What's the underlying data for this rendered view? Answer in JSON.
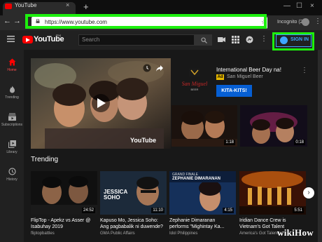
{
  "browser": {
    "tab_title": "YouTube",
    "tab_close": "×",
    "new_tab": "+",
    "url": "https://www.youtube.com",
    "incognito_label": "Incognito (2)",
    "window_controls": [
      "—",
      "☐",
      "×"
    ]
  },
  "youtube": {
    "logo_text": "YouTube",
    "logo_sup": "PH",
    "search_placeholder": "Search",
    "sign_in_label": "SIGN IN"
  },
  "sidebar": {
    "items": [
      {
        "label": "Home",
        "icon": "home-icon",
        "active": true
      },
      {
        "label": "Trending",
        "icon": "fire-icon"
      },
      {
        "label": "Subscriptions",
        "icon": "subscriptions-icon"
      },
      {
        "label": "Library",
        "icon": "library-icon"
      },
      {
        "label": "History",
        "icon": "history-icon"
      }
    ]
  },
  "feature": {
    "watermark": "YouTube"
  },
  "promo": {
    "logo_text": "San Miguel",
    "logo_sub": "BEER",
    "title": "International Beer Day na!",
    "ad_badge": "Ad",
    "advertiser": "San Miguel Beer",
    "cta": "KITA-KITS!"
  },
  "promo_thumbs": [
    {
      "duration": "1:18"
    },
    {
      "duration": "0:18"
    }
  ],
  "trending": {
    "heading": "Trending",
    "videos": [
      {
        "title": "FlipTop - Apekz vs Asser @ Isabuhay 2019",
        "channel": "fliptopbattles",
        "duration": "24:52"
      },
      {
        "title": "Kapuso Mo, Jessica Soho: Ang pagbabalik ni duwende?",
        "channel": "GMA Public Affairs",
        "duration": "11:10",
        "overlay": "JESSICA SOHO"
      },
      {
        "title": "Zephanie Dimaranan performs \"Mighintay Ka...",
        "channel": "Idol Philippines",
        "duration": "4:15",
        "overlay_top": "GRAND FINALE",
        "overlay": "ZEPHANIE DIMARANAN"
      },
      {
        "title": "Iridian Dance Crew is Vietnam's Got Talent",
        "channel": "America's Got Talent",
        "duration": "5:51"
      }
    ]
  },
  "watermark": "wikiHow",
  "colors": {
    "highlight": "#1df00e",
    "brand_red": "#ff0000",
    "link_blue": "#3ea6ff"
  }
}
